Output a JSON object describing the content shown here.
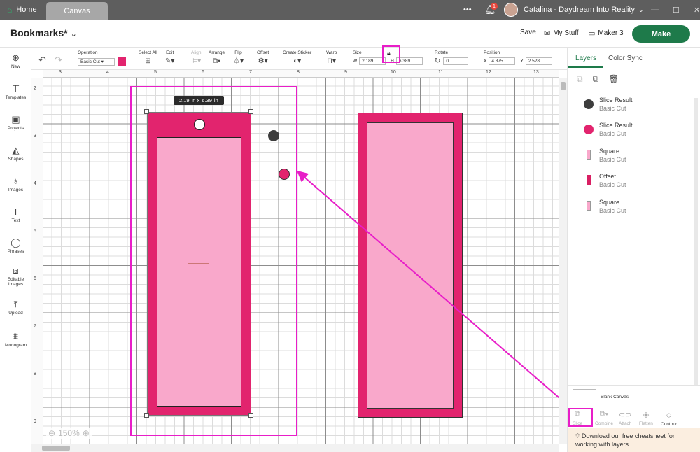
{
  "titlebar": {
    "home_tab": "Home",
    "canvas_tab": "Canvas",
    "more": "•••",
    "notification_count": "1",
    "user_name": "Catalina - Daydream Into Reality"
  },
  "header": {
    "project_title": "Bookmarks*",
    "save": "Save",
    "my_stuff": "My Stuff",
    "machine": "Maker 3",
    "make": "Make"
  },
  "toolbar": {
    "operation_label": "Operation",
    "operation_value": "Basic Cut",
    "select_all": "Select All",
    "edit": "Edit",
    "align": "Align",
    "arrange": "Arrange",
    "flip": "Flip",
    "offset": "Offset",
    "create_sticker": "Create Sticker",
    "warp": "Warp",
    "size": "Size",
    "w_label": "W",
    "w_value": "2.189",
    "h_label": "H",
    "h_value": "6.389",
    "rotate": "Rotate",
    "rotate_value": "0",
    "position": "Position",
    "x_label": "X",
    "x_value": "4.875",
    "y_label": "Y",
    "y_value": "2.528"
  },
  "sidebar": {
    "items": [
      {
        "label": "New",
        "icon": "plus-circle-icon"
      },
      {
        "label": "Templates",
        "icon": "shirt-icon"
      },
      {
        "label": "Projects",
        "icon": "projects-icon"
      },
      {
        "label": "Shapes",
        "icon": "shapes-icon"
      },
      {
        "label": "Images",
        "icon": "bulb-icon"
      },
      {
        "label": "Text",
        "icon": "text-icon"
      },
      {
        "label": "Phrases",
        "icon": "speech-icon"
      },
      {
        "label": "Editable Images",
        "icon": "editable-icon"
      },
      {
        "label": "Upload",
        "icon": "upload-icon"
      },
      {
        "label": "Monogram",
        "icon": "monogram-icon"
      }
    ]
  },
  "rulers": {
    "top": [
      "3",
      "4",
      "5",
      "6",
      "7",
      "8",
      "9",
      "10",
      "11",
      "12",
      "13"
    ],
    "left": [
      "2",
      "3",
      "4",
      "5",
      "6",
      "7",
      "8",
      "9"
    ]
  },
  "canvas": {
    "size_tooltip_w": "2.19",
    "size_tooltip_x": "in x",
    "size_tooltip_h": "6.39",
    "size_tooltip_unit": "in",
    "zoom": "150%",
    "colors": {
      "pink_dark": "#e2246e",
      "pink_light": "#f9a8cb",
      "highlight": "#e81ec8",
      "dark_dot": "#3d3d3d"
    }
  },
  "panel": {
    "tab_layers": "Layers",
    "tab_color_sync": "Color Sync",
    "layers": [
      {
        "title": "Slice Result",
        "sub": "Basic Cut",
        "swatch": "#3d3d3d",
        "shape": "circle"
      },
      {
        "title": "Slice Result",
        "sub": "Basic Cut",
        "swatch": "#e2246e",
        "shape": "circle"
      },
      {
        "title": "Square",
        "sub": "Basic Cut",
        "swatch": "#f9a8cb",
        "shape": "rect"
      },
      {
        "title": "Offset",
        "sub": "Basic Cut",
        "swatch": "#d91f63",
        "shape": "rect"
      },
      {
        "title": "Square",
        "sub": "Basic Cut",
        "swatch": "#f9a8cb",
        "shape": "rect"
      }
    ],
    "blank_canvas": "Blank Canvas",
    "bottom_tools": [
      "Slice",
      "Combine",
      "Attach",
      "Flatten",
      "Contour"
    ],
    "tip_line1": "Download our free cheatsheet for",
    "tip_line2": "working with layers."
  }
}
